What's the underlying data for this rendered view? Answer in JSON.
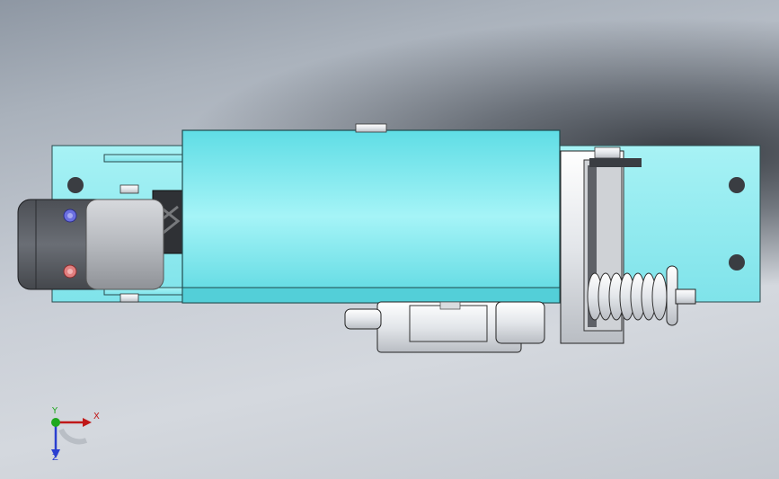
{
  "viewport": {
    "background_gradient": [
      "#8e97a3",
      "#c9ced6",
      "#c3c8cf"
    ],
    "model_colors": {
      "plate": "#8ee8ee",
      "housing": "#66dfe6",
      "motor": "#5a5d63",
      "steel": "#e9ebee",
      "blue_knob": "#6b6fe0",
      "red_knob": "#e17f7f"
    }
  },
  "triad": {
    "x_label": "X",
    "y_label": "Y",
    "z_label": "Z",
    "colors": {
      "x": "#c01818",
      "y": "#1fa81f",
      "z": "#2a3fd0"
    }
  }
}
